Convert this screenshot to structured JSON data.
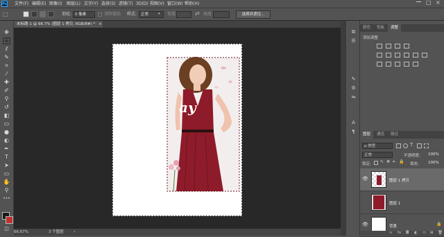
{
  "app": {
    "logo": "Ps"
  },
  "menubar": {
    "items": [
      "文件(F)",
      "编辑(E)",
      "图像(I)",
      "图层(L)",
      "文字(Y)",
      "选择(S)",
      "滤镜(T)",
      "3D(D)",
      "视图(V)",
      "窗口(W)",
      "帮助(H)"
    ]
  },
  "options": {
    "feather_label": "羽化:",
    "feather_value": "0 像素",
    "antialias_label": "消除锯齿",
    "style_label": "样式:",
    "style_value": "正常",
    "width_label": "宽度:",
    "height_label": "高度:",
    "select_mask_button": "选择并遮住..."
  },
  "document": {
    "tab_title": "未标题-1 @ 66.7% (图层 1 拷贝, RGB/8#) *",
    "close": "×",
    "overlay_text": "ay"
  },
  "status": {
    "zoom": "66.67%",
    "info": "3 个图层"
  },
  "panels": {
    "top_tabs": [
      "颜色",
      "色板",
      "调整"
    ],
    "active_top_tab": "调整",
    "adjust_title": "添加调整",
    "layers_tabs": [
      "图层",
      "通道",
      "路径"
    ],
    "active_layers_tab": "图层",
    "filter_kind": "ρ 类型",
    "blend_mode": "正常",
    "opacity_label": "不透明度:",
    "opacity_value": "100%",
    "lock_label": "锁定:",
    "fill_label": "填充:",
    "fill_value": "100%",
    "layers": [
      {
        "name": "图层 1 拷贝",
        "visible": true,
        "selected": true
      },
      {
        "name": "图层 1",
        "visible": false,
        "selected": false
      },
      {
        "name": "背景",
        "visible": true,
        "selected": false,
        "locked": true
      }
    ]
  },
  "colors": {
    "accent": "#31a8ff",
    "dress": "#8e1b2a",
    "foreground": "#1a1a1a",
    "background_swatch": "#c03030"
  }
}
